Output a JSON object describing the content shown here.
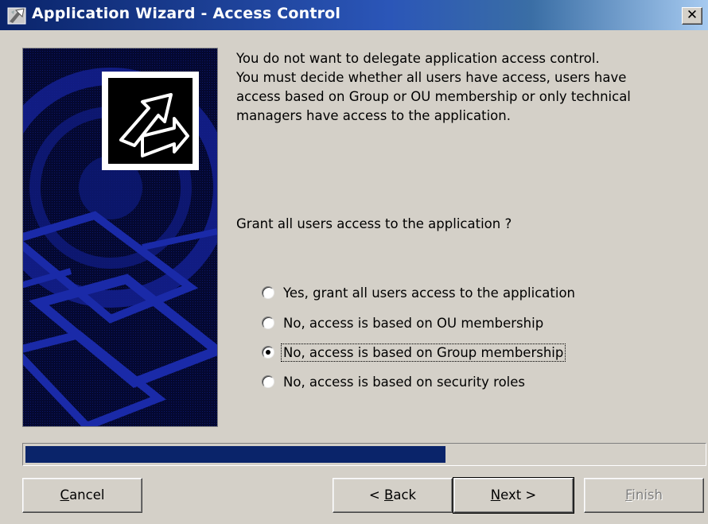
{
  "window": {
    "title": "Application Wizard - Access Control",
    "close_label": "✕"
  },
  "content": {
    "intro": "You do not want to delegate application access control.\nYou must decide whether all users have access, users have\naccess based on Group or OU membership or only technical\nmanagers have access to the application.",
    "question": "Grant all users access to the application ?"
  },
  "options": [
    {
      "label": "Yes, grant all users access to the application",
      "selected": false
    },
    {
      "label": "No, access is based on OU membership",
      "selected": false
    },
    {
      "label": "No, access is based on Group membership",
      "selected": true
    },
    {
      "label": "No, access is based on security roles",
      "selected": false
    }
  ],
  "progress": {
    "fraction": 0.62
  },
  "buttons": {
    "cancel": {
      "pre": "",
      "mn": "C",
      "post": "ancel"
    },
    "back": {
      "pre": "< ",
      "mn": "B",
      "post": "ack"
    },
    "next": {
      "pre": "",
      "mn": "N",
      "post": "ext >"
    },
    "finish": {
      "pre": "",
      "mn": "F",
      "post": "inish"
    }
  },
  "colors": {
    "title_bar_start": "#0a246a",
    "dialog_face": "#d4d0c8",
    "progress": "#0a246a",
    "side_panel": "#050a35"
  },
  "icons": {
    "title": "wizard-icon",
    "side_logo": "arrows-logo-icon"
  }
}
